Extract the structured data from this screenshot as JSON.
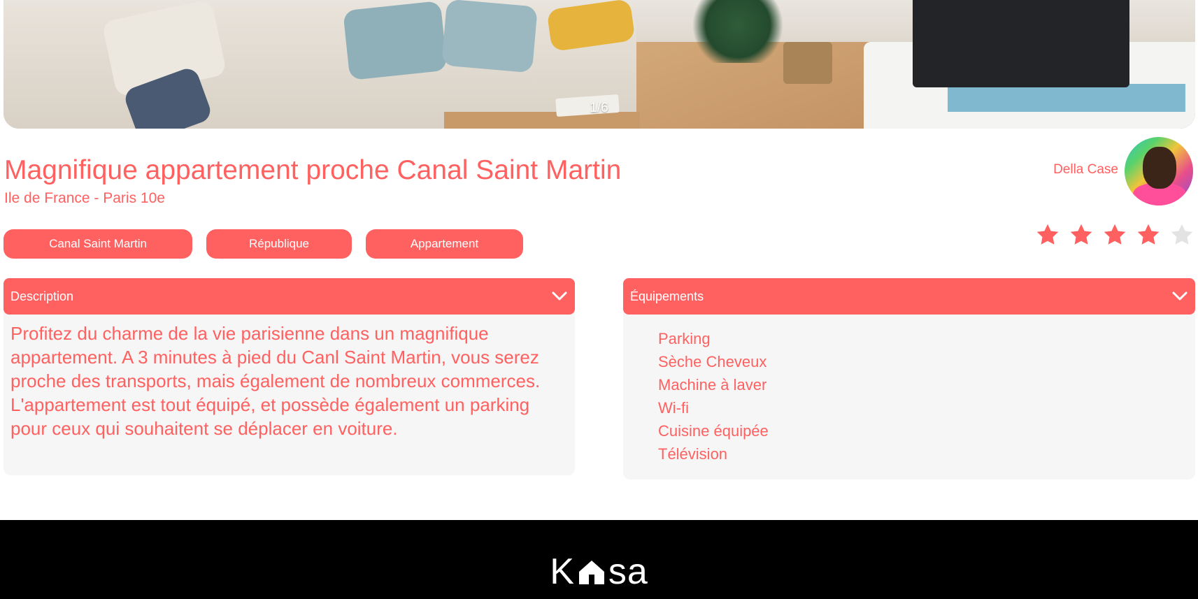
{
  "gallery": {
    "counter": "1/6"
  },
  "listing": {
    "title": "Magnifique appartement proche Canal Saint Martin",
    "location": "Ile de France - Paris 10e",
    "tags": [
      "Canal Saint Martin",
      "République",
      "Appartement"
    ],
    "rating": 4,
    "rating_max": 5
  },
  "host": {
    "name": "Della Case"
  },
  "description": {
    "title": "Description",
    "text": "Profitez du charme de la vie parisienne dans un magnifique appartement. A 3 minutes à pied du Canl Saint Martin, vous serez proche des transports, mais également de nombreux commerces. L'appartement est tout équipé, et possède également un parking pour ceux qui souhaitent se déplacer en voiture.",
    "icon": "chevron-down-icon"
  },
  "equipments": {
    "title": "Équipements",
    "items": [
      "Parking",
      "Sèche Cheveux",
      "Machine à laver",
      "Wi-fi",
      "Cuisine équipée",
      "Télévision"
    ],
    "icon": "chevron-down-icon"
  },
  "footer": {
    "logo_left": "K",
    "logo_right": "sa"
  },
  "colors": {
    "accent": "#ff6060",
    "star_inactive": "#e3e3e3",
    "panel_bg": "#f6f6f6",
    "footer_bg": "#000000"
  }
}
